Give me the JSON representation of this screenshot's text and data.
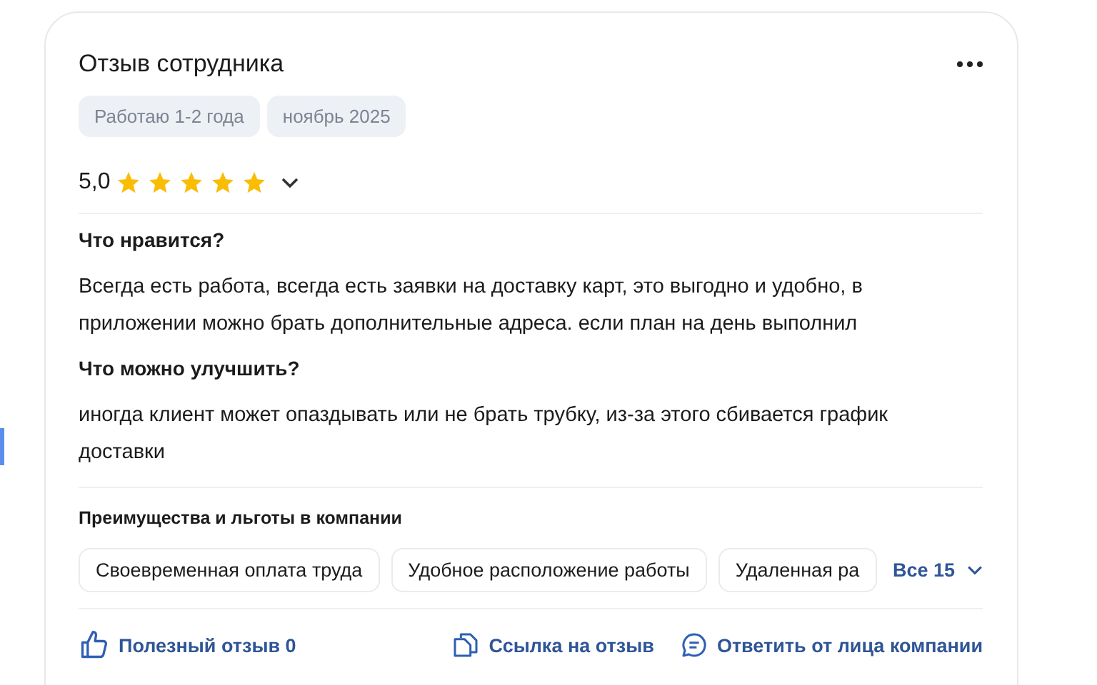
{
  "review": {
    "title": "Отзыв сотрудника",
    "tags": [
      "Работаю 1-2 года",
      "ноябрь 2025"
    ],
    "rating": "5,0",
    "stars": 5,
    "sections": [
      {
        "heading": "Что нравится?",
        "text": "Всегда есть работа, всегда есть заявки на доставку карт, это выгодно и удобно, в приложении можно брать дополнительные адреса. если план на день выполнил"
      },
      {
        "heading": "Что можно улучшить?",
        "text": "иногда клиент может опаздывать или не брать трубку, из-за этого сбивается график доставки"
      }
    ],
    "benefits": {
      "heading": "Преимущества и льготы в компании",
      "items": [
        "Своевременная оплата труда",
        "Удобное расположение работы",
        "Удаленная ра"
      ],
      "more": "Все 15"
    },
    "actions": {
      "helpful": "Полезный отзыв 0",
      "link": "Ссылка на отзыв",
      "reply": "Ответить от лица компании"
    }
  }
}
